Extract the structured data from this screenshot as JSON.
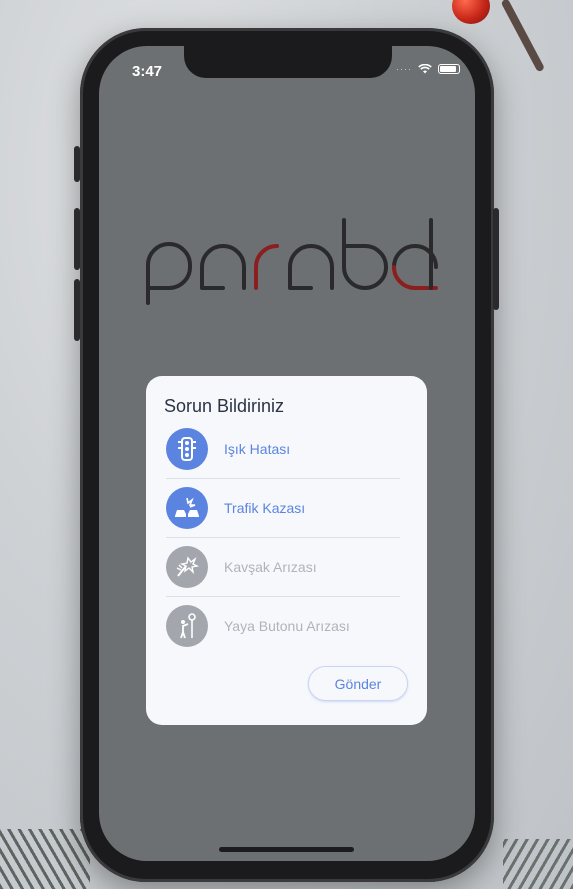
{
  "status_bar": {
    "time": "3:47"
  },
  "dialog": {
    "title": "Sorun Bildiriniz",
    "options": [
      {
        "label": "Işık Hatası",
        "icon": "traffic-light-icon",
        "state": "active"
      },
      {
        "label": "Trafik Kazası",
        "icon": "car-crash-icon",
        "state": "active"
      },
      {
        "label": "Kavşak Arızası",
        "icon": "broken-signal-icon",
        "state": "inactive"
      },
      {
        "label": "Yaya Butonu Arızası",
        "icon": "pedestrian-button-icon",
        "state": "inactive"
      }
    ],
    "send_label": "Gönder"
  },
  "logo": {
    "text": "parabol",
    "accent_color": "#8a1f1f",
    "dark_color": "#2a2a2c"
  },
  "colors": {
    "accent": "#5b84e0",
    "inactive": "#a4a6ad",
    "screen_bg": "#6d7072"
  }
}
